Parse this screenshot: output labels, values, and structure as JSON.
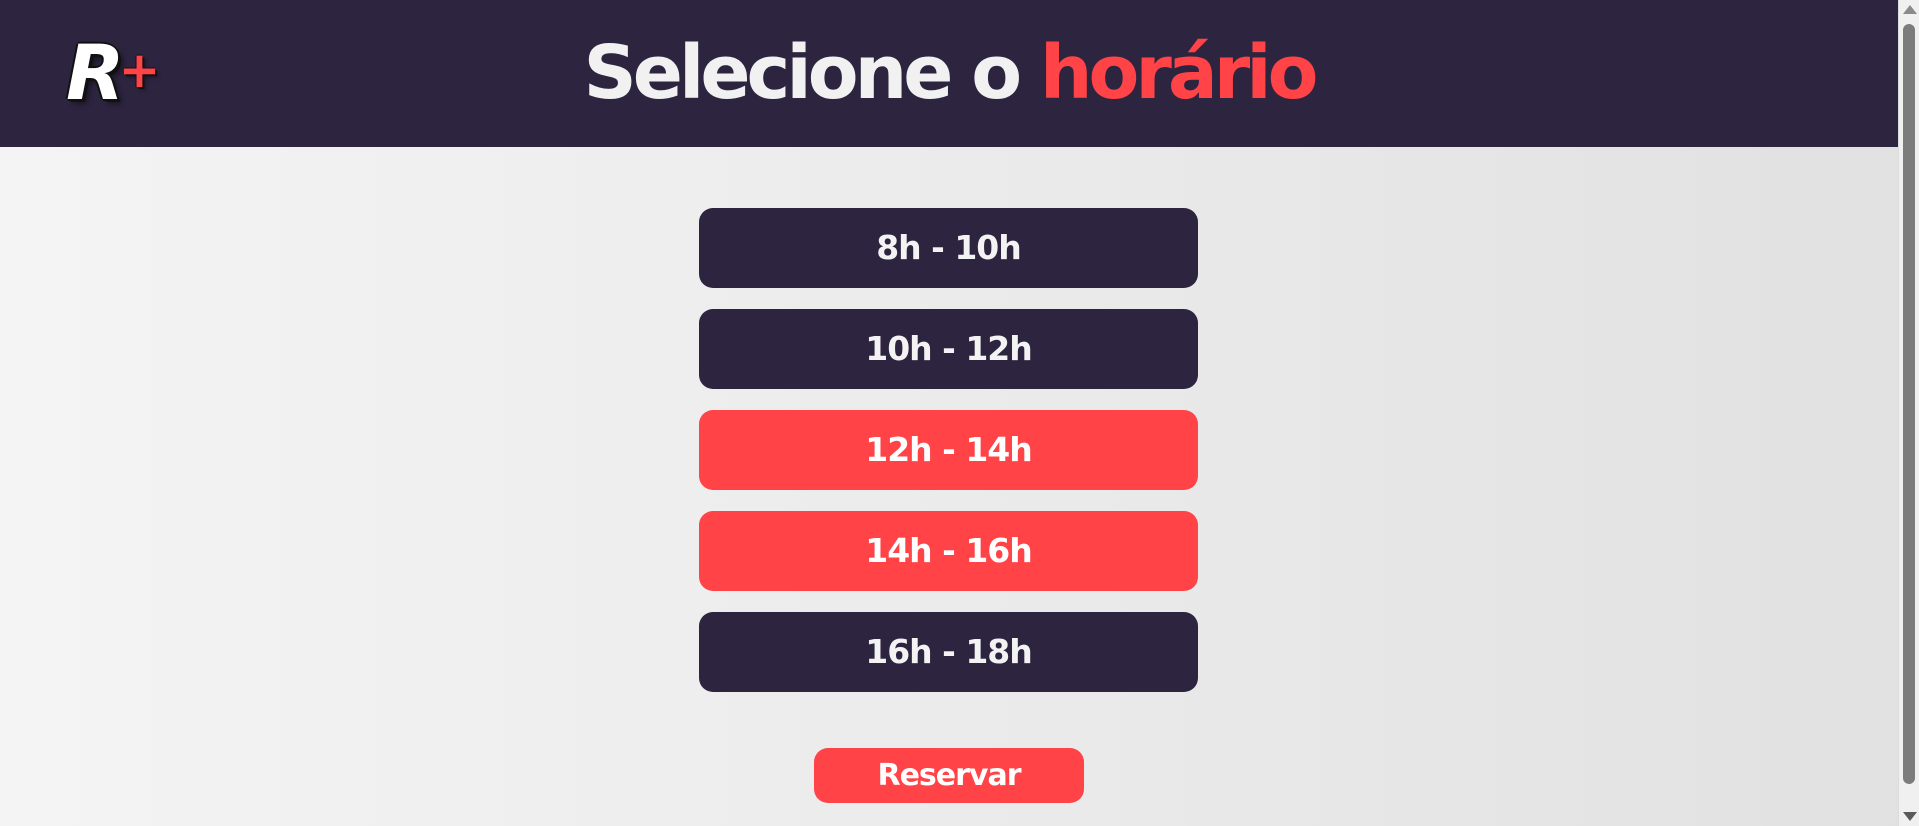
{
  "header": {
    "logo": {
      "letter": "R",
      "plus": "+"
    },
    "title_main": "Selecione o",
    "title_accent": "horário"
  },
  "slots": [
    {
      "label": "8h - 10h",
      "selected": false
    },
    {
      "label": "10h - 12h",
      "selected": false
    },
    {
      "label": "12h - 14h",
      "selected": true
    },
    {
      "label": "14h - 16h",
      "selected": true
    },
    {
      "label": "16h - 18h",
      "selected": false
    }
  ],
  "actions": {
    "reserve_label": "Reservar"
  },
  "colors": {
    "header_bg": "#2d2540",
    "accent": "#ff4347",
    "slot_bg": "#2d2540",
    "text_light": "#f3f3f3"
  }
}
